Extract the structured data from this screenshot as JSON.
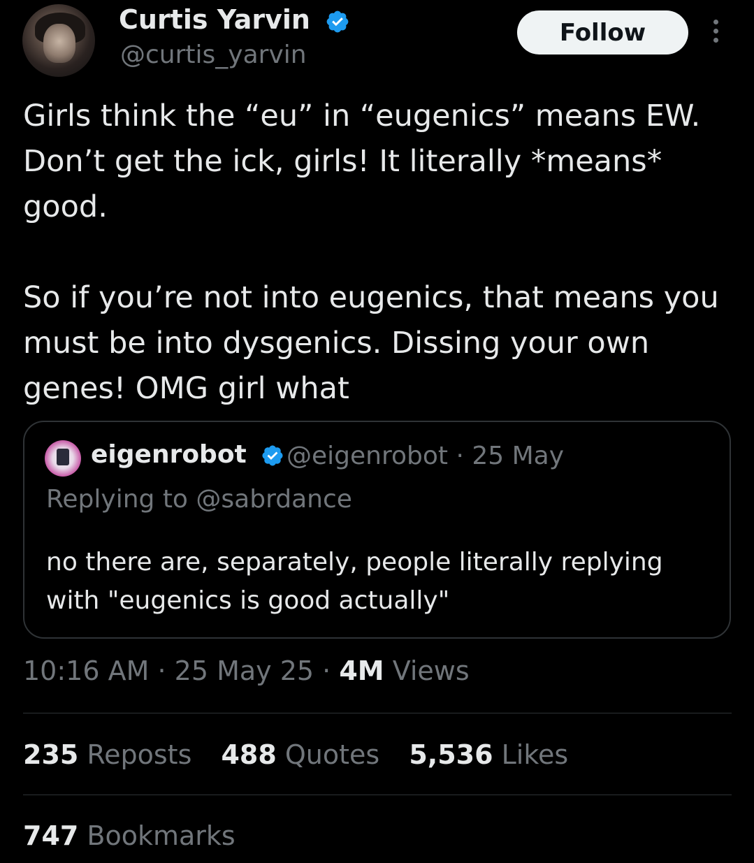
{
  "author": {
    "name": "Curtis Yarvin",
    "handle": "@curtis_yarvin",
    "verified_icon": "verified-badge-icon"
  },
  "actions": {
    "follow_label": "Follow",
    "more_icon": "more-vertical-icon"
  },
  "tweet": {
    "paragraph_1": "Girls think the “eu” in “eugenics” means EW. Don’t get the ick, girls! It literally *means* good.",
    "paragraph_2": "So if you’re not into eugenics, that means you must be into dysgenics. Dissing your own genes! OMG girl what"
  },
  "quoted": {
    "name": "eigenrobot",
    "handle": "@eigenrobot",
    "date": "25 May",
    "replying_to": "Replying to @sabrdance",
    "text": "no there are, separately, people literally replying with \"eugenics is good actually\""
  },
  "timestamp": {
    "time": "10:16 AM",
    "date": "25 May 25",
    "views_count": "4M",
    "views_label": "Views"
  },
  "stats": {
    "reposts_count": "235",
    "reposts_label": "Reposts",
    "quotes_count": "488",
    "quotes_label": "Quotes",
    "likes_count": "5,536",
    "likes_label": "Likes",
    "bookmarks_count": "747",
    "bookmarks_label": "Bookmarks"
  },
  "colors": {
    "background": "#000000",
    "text": "#e7e9ea",
    "secondary_text": "#71767b",
    "verified_blue": "#1d9bf0",
    "border": "#2f3336"
  }
}
